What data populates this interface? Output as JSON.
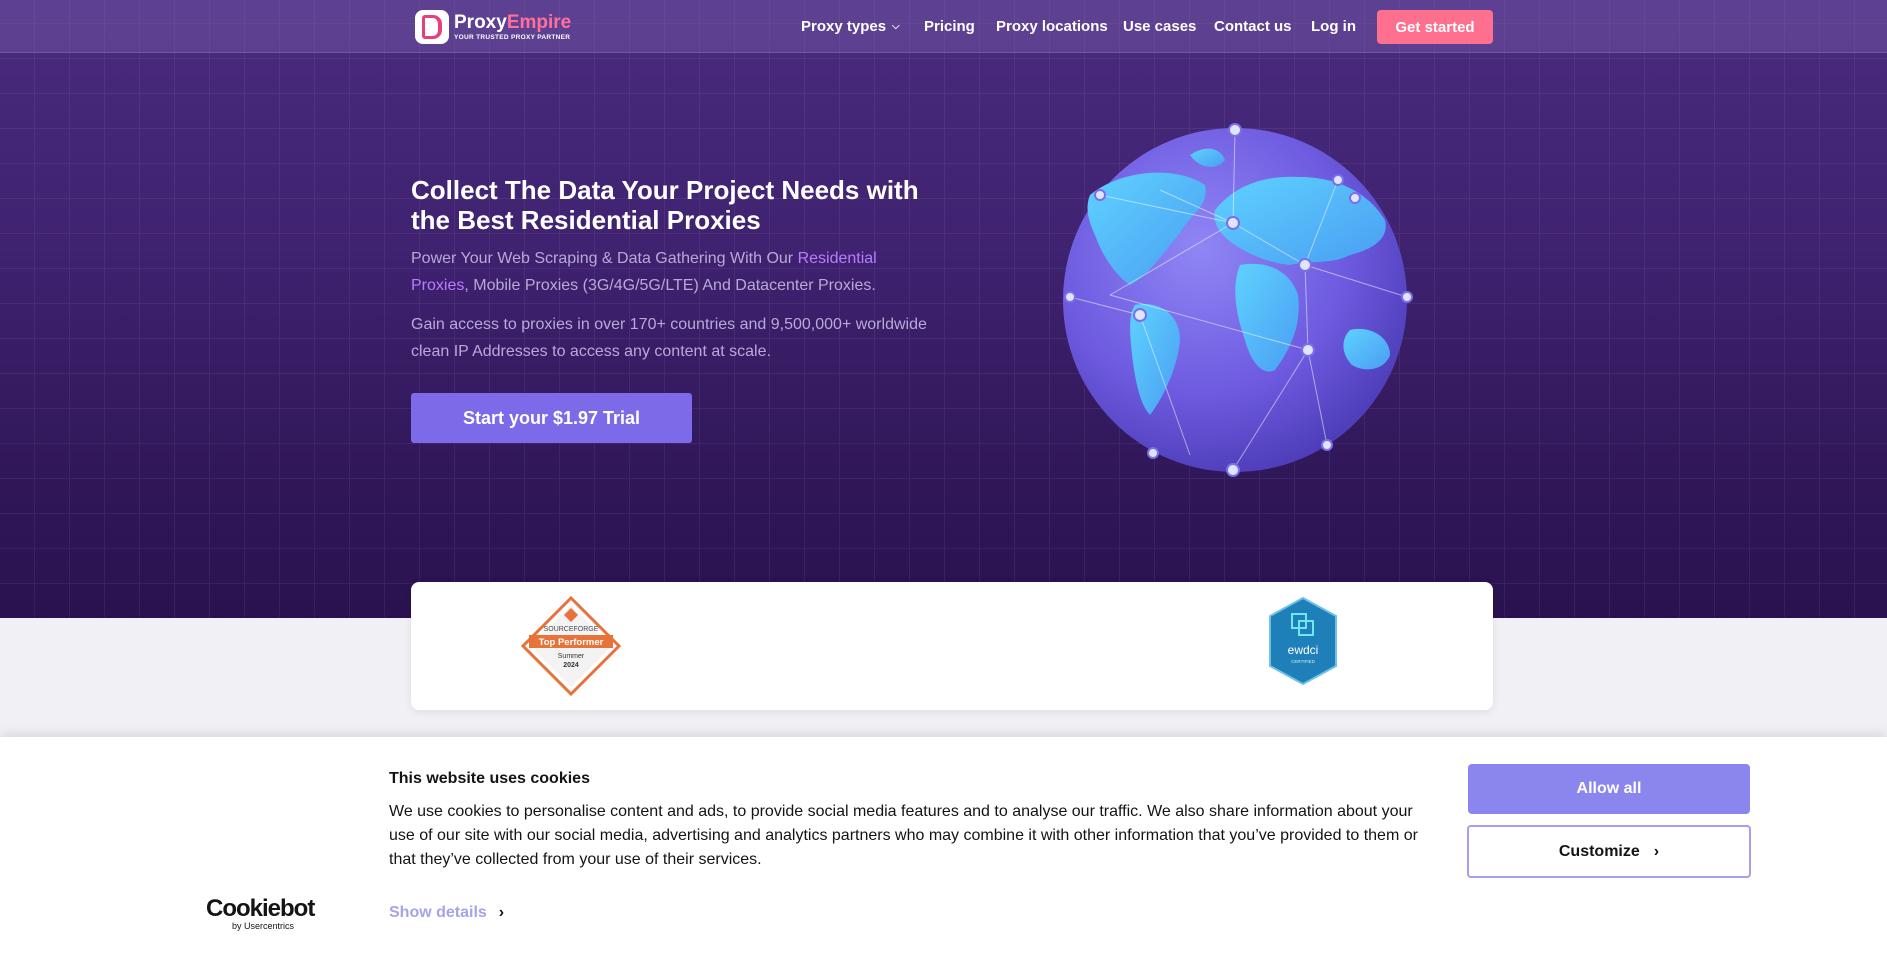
{
  "header": {
    "logo": {
      "name_first": "Proxy",
      "name_second": "Empire",
      "tagline": "YOUR TRUSTED PROXY PARTNER"
    },
    "nav": [
      {
        "label": "Proxy types",
        "has_dropdown": true
      },
      {
        "label": "Pricing"
      },
      {
        "label": "Proxy locations"
      },
      {
        "label": "Use cases"
      },
      {
        "label": "Contact us"
      },
      {
        "label": "Log in"
      }
    ],
    "cta_label": "Get started"
  },
  "hero": {
    "title": "Collect The Data Your Project Needs with the Best Residential Proxies",
    "subtitle_before": "Power Your Web Scraping & Data Gathering With Our ",
    "subtitle_link": "Residential Proxies",
    "subtitle_after": ", Mobile Proxies (3G/4G/5G/LTE) And Datacenter Proxies.",
    "description": "Gain access to proxies in over 170+ countries and 9,500,000+ worldwide clean IP Addresses to access any content at scale.",
    "trial_button": "Start your $1.97 Trial",
    "globe_icon": "globe-network-icon"
  },
  "badges": {
    "sourceforge": {
      "brand": "SOURCEFORGE",
      "label": "Top Performer",
      "season": "Summer",
      "year": "2024"
    },
    "ewdci": {
      "label": "ewdci",
      "sub": "CERTIFIED"
    }
  },
  "cookie_banner": {
    "title": "This website uses cookies",
    "text": "We use cookies to personalise content and ads, to provide social media features and to analyse our traffic. We also share information about your use of our site with our social media, advertising and analytics partners who may combine it with other information that you’ve provided to them or that they’ve collected from your use of their services.",
    "show_details": "Show details",
    "allow_all": "Allow all",
    "customize": "Customize",
    "brand": "Cookiebot",
    "brand_by": "by Usercentrics"
  },
  "colors": {
    "hero_bg": "#3f2270",
    "accent_pink": "#ff6f8e",
    "accent_purple": "#7c6ae9",
    "cookie_button": "#8b85ee"
  }
}
